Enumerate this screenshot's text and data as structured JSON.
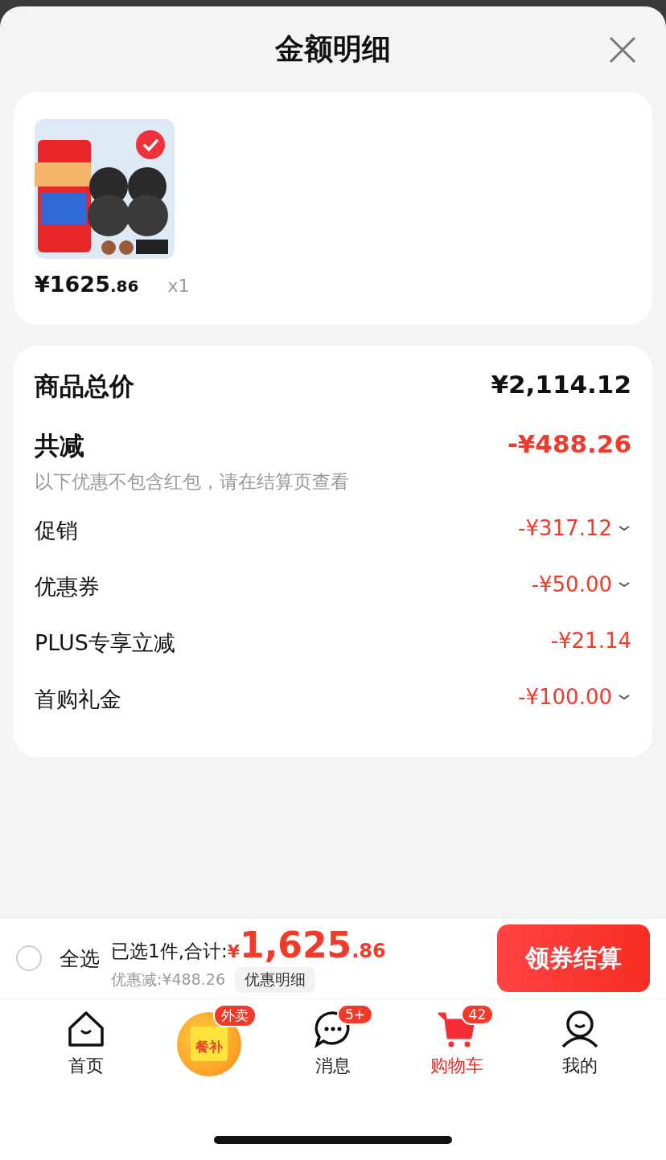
{
  "header": {
    "title": "金额明细"
  },
  "product": {
    "selected": true,
    "price_main": "¥1625",
    "price_cents": ".86",
    "quantity": "x1"
  },
  "summary": [
    {
      "kind": "total",
      "label": "商品总价",
      "amount": "¥2,114.12"
    },
    {
      "kind": "reduce",
      "label": "共减",
      "amount": "-¥488.26",
      "note": "以下优惠不包含红包，请在结算页查看"
    },
    {
      "kind": "item",
      "label": "促销",
      "amount": "-¥317.12",
      "expandable": true
    },
    {
      "kind": "item",
      "label": "优惠券",
      "amount": "-¥50.00",
      "expandable": true
    },
    {
      "kind": "item",
      "label": "PLUS专享立减",
      "amount": "-¥21.14",
      "expandable": false
    },
    {
      "kind": "item",
      "label": "首购礼金",
      "amount": "-¥100.00",
      "expandable": true
    }
  ],
  "checkout": {
    "select_all_checked": false,
    "select_all": "全选",
    "selected_text": "已选1件,合计:",
    "currency": "¥",
    "total_main": "1,625",
    "total_cents": ".86",
    "discount_text": "优惠减:¥488.26",
    "discount_detail": "优惠明细",
    "button": "领券结算"
  },
  "tabbar": [
    {
      "kind": "home",
      "label": "首页",
      "selected": false
    },
    {
      "kind": "takeout",
      "badge": "外卖",
      "tile": "餐补"
    },
    {
      "kind": "message",
      "label": "消息",
      "badge": "5+",
      "selected": false
    },
    {
      "kind": "cart",
      "label": "购物车",
      "badge": "42",
      "selected": true
    },
    {
      "kind": "me",
      "label": "我的",
      "selected": false
    }
  ]
}
